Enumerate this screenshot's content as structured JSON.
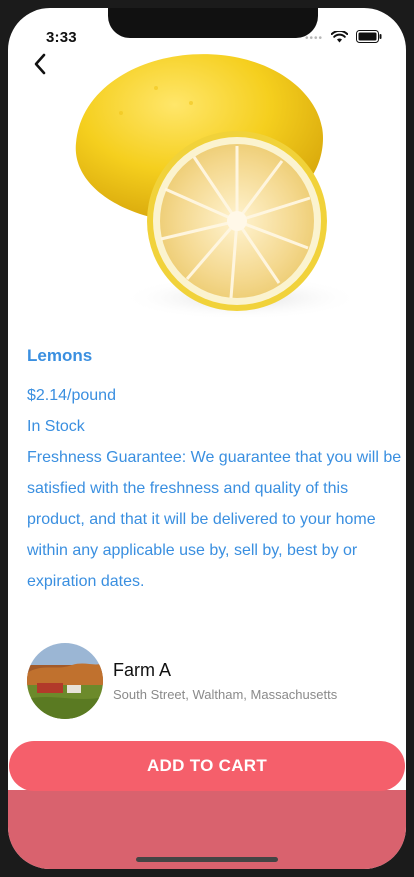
{
  "status_bar": {
    "time": "3:33"
  },
  "product": {
    "name": "Lemons",
    "price": "$2.14/pound",
    "stock": "In Stock",
    "description": "Freshness Guarantee: We guarantee that you will be satisfied with the freshness and quality of this product, and that it will be delivered to your home within any applicable use by, sell by, best by or expiration dates."
  },
  "farm": {
    "name": "Farm A",
    "address": "South Street, Waltham, Massachusetts"
  },
  "cart": {
    "label": "ADD TO CART"
  },
  "colors": {
    "accent_text": "#3a8fe0",
    "button": "#f55f6b",
    "bottom_panel": "#d9626e"
  },
  "icons": {
    "back": "chevron-left-icon",
    "signal": "signal-dots-icon",
    "wifi": "wifi-icon",
    "battery": "battery-icon"
  }
}
